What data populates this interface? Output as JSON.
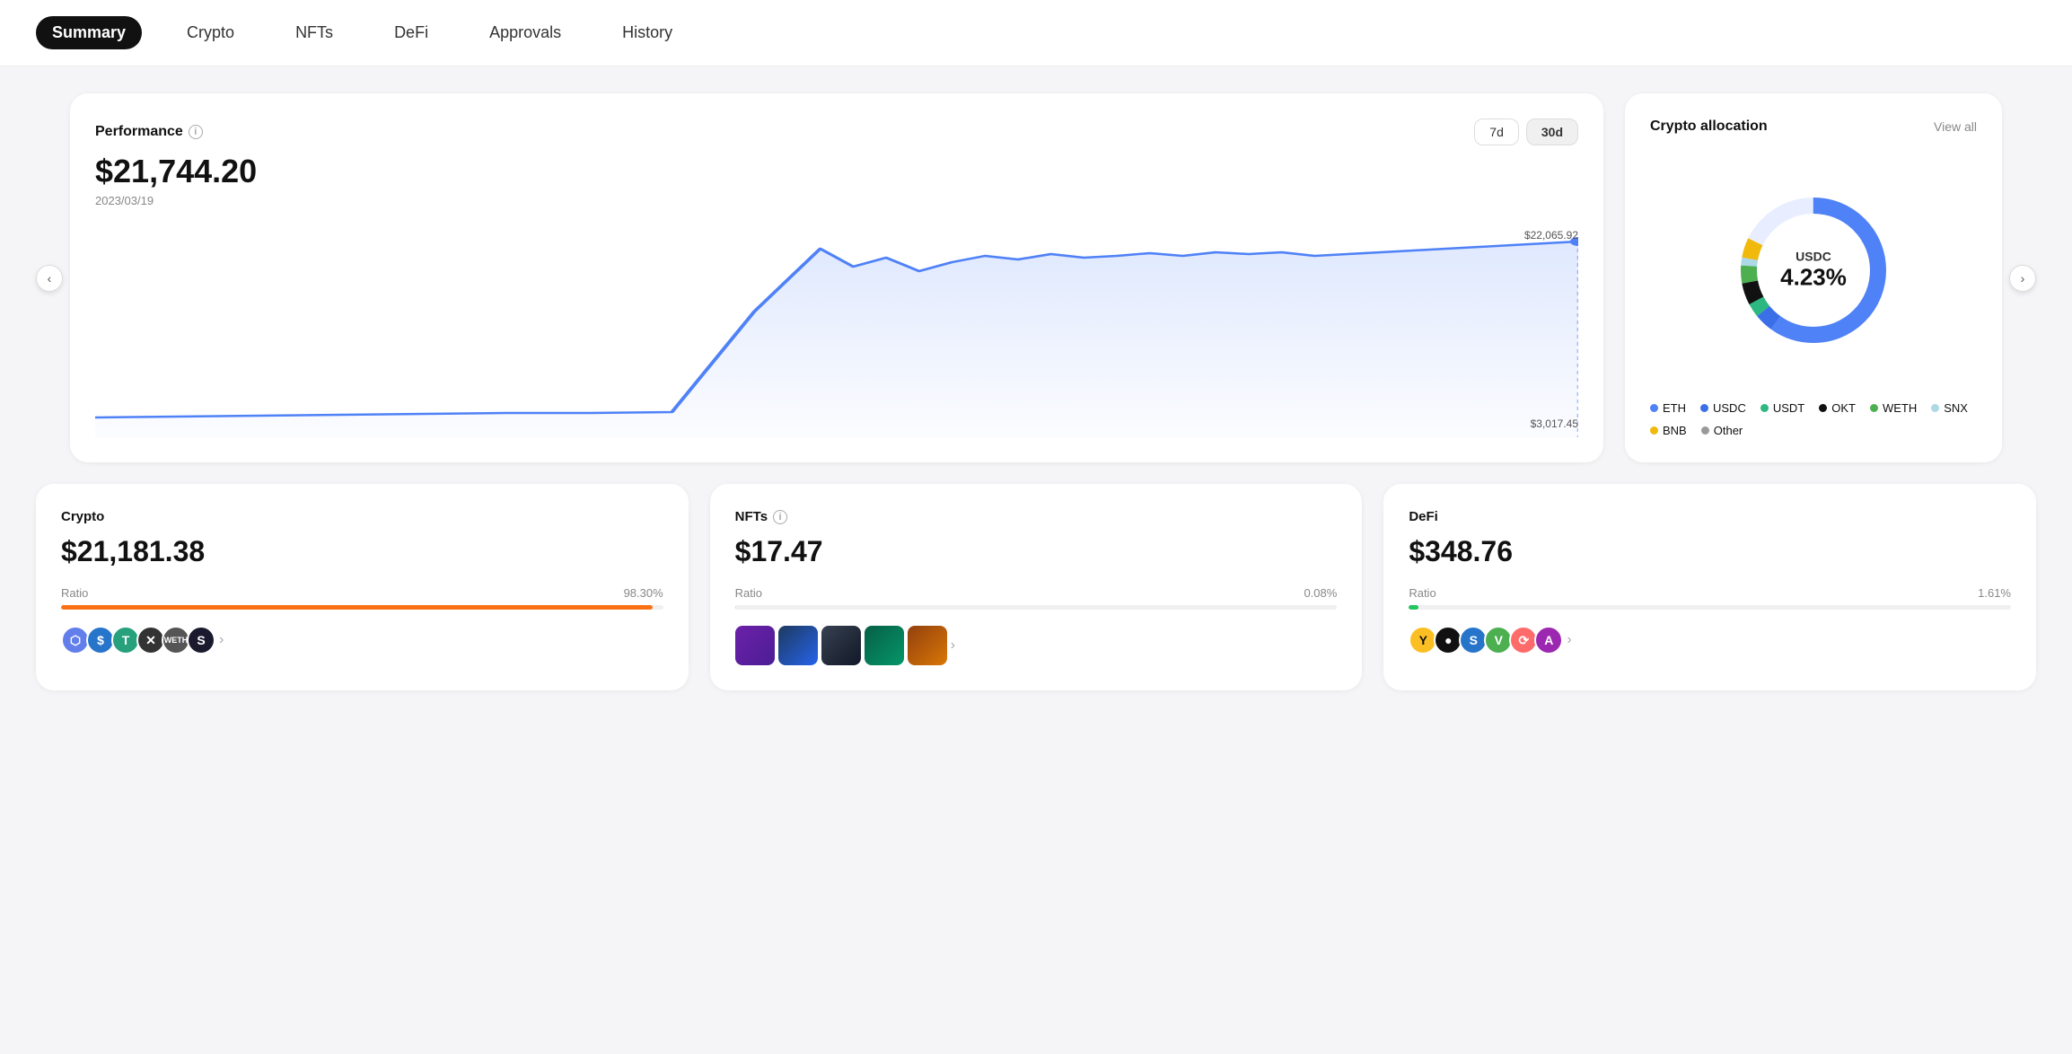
{
  "nav": {
    "items": [
      {
        "label": "Summary",
        "active": true
      },
      {
        "label": "Crypto",
        "active": false
      },
      {
        "label": "NFTs",
        "active": false
      },
      {
        "label": "DeFi",
        "active": false
      },
      {
        "label": "Approvals",
        "active": false
      },
      {
        "label": "History",
        "active": false
      }
    ]
  },
  "performance": {
    "title": "Performance",
    "amount": "$21,744.20",
    "date": "2023/03/19",
    "time_buttons": [
      {
        "label": "7d",
        "active": false
      },
      {
        "label": "30d",
        "active": true
      }
    ],
    "chart_high": "$22,065.92",
    "chart_low": "$3,017.45"
  },
  "allocation": {
    "title": "Crypto allocation",
    "view_all": "View all",
    "center_label": "USDC",
    "center_pct": "4.23%",
    "legend": [
      {
        "label": "ETH",
        "color": "#4F81F7"
      },
      {
        "label": "USDC",
        "color": "#3B6FE8"
      },
      {
        "label": "USDT",
        "color": "#2DB882"
      },
      {
        "label": "OKT",
        "color": "#111111"
      },
      {
        "label": "WETH",
        "color": "#4CAF50"
      },
      {
        "label": "SNX",
        "color": "#ADD8E6"
      },
      {
        "label": "BNB",
        "color": "#F0B90B"
      },
      {
        "label": "Other",
        "color": "#999999"
      }
    ]
  },
  "crypto_card": {
    "title": "Crypto",
    "amount": "$21,181.38",
    "ratio_label": "Ratio",
    "ratio_pct": "98.30%",
    "bar_color": "#F97316",
    "bar_width": "98.3"
  },
  "nfts_card": {
    "title": "NFTs",
    "amount": "$17.47",
    "ratio_label": "Ratio",
    "ratio_pct": "0.08%",
    "bar_color": "#D1D5DB",
    "bar_width": "0.08"
  },
  "defi_card": {
    "title": "DeFi",
    "amount": "$348.76",
    "ratio_label": "Ratio",
    "ratio_pct": "1.61%",
    "bar_color": "#22C55E",
    "bar_width": "1.61"
  }
}
